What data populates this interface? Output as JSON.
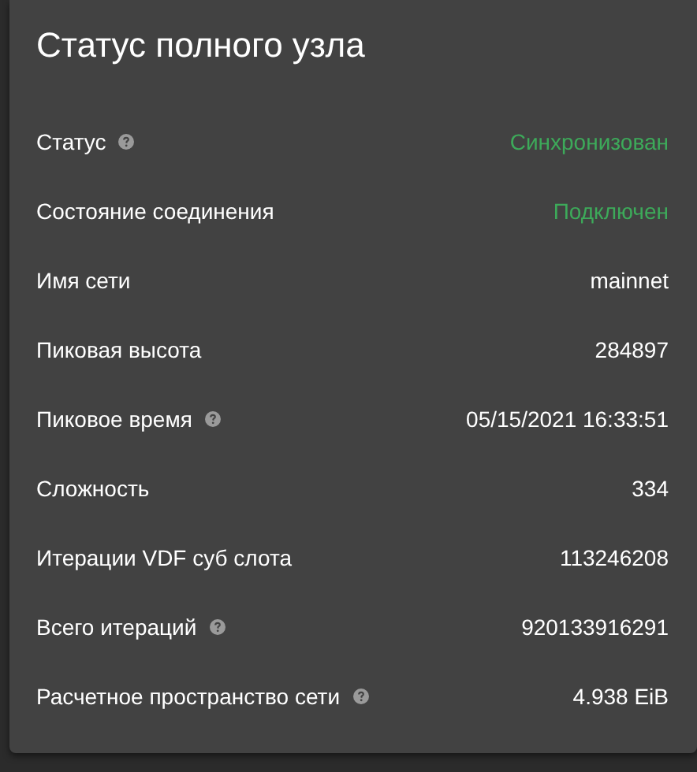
{
  "card": {
    "title": "Статус полного узла"
  },
  "rows": [
    {
      "label": "Статус",
      "help": true,
      "kind": "status",
      "value": "Синхронизован"
    },
    {
      "label": "Состояние соединения",
      "help": false,
      "kind": "status",
      "value": "Подключен"
    },
    {
      "label": "Имя сети",
      "help": false,
      "kind": "plain",
      "value": "mainnet"
    },
    {
      "label": "Пиковая высота",
      "help": false,
      "kind": "plain",
      "value": "284897"
    },
    {
      "label": "Пиковое время",
      "help": true,
      "kind": "plain",
      "value": "05/15/2021 16:33:51"
    },
    {
      "label": "Сложность",
      "help": false,
      "kind": "plain",
      "value": "334"
    },
    {
      "label": "Итерации VDF суб слота",
      "help": false,
      "kind": "plain",
      "value": "113246208"
    },
    {
      "label": "Всего итераций",
      "help": true,
      "kind": "plain",
      "value": "920133916291"
    },
    {
      "label": "Расчетное пространство сети",
      "help": true,
      "kind": "plain",
      "value": "4.938 EiB"
    }
  ]
}
